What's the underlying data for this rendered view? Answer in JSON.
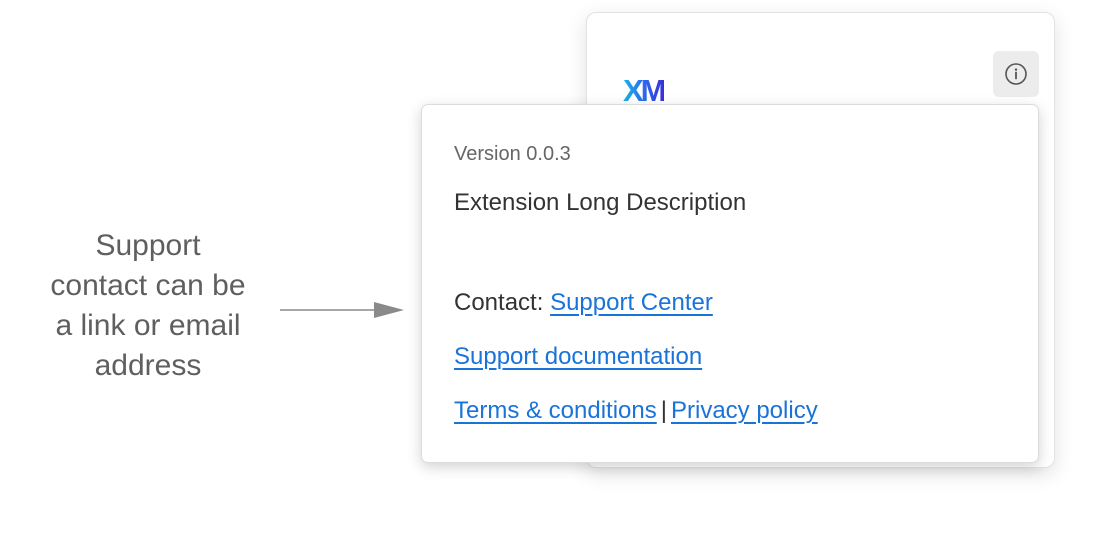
{
  "annotation": {
    "lines": [
      "Support",
      "contact can be",
      "a link or email",
      "address"
    ]
  },
  "card": {
    "logo_text": "XM",
    "info_icon": "info-icon"
  },
  "popover": {
    "version": "Version 0.0.3",
    "description": "Extension Long Description",
    "contact_label": "Contact:",
    "contact_link": "Support Center",
    "documentation_link": "Support documentation",
    "terms_link": "Terms & conditions",
    "separator": "|",
    "privacy_link": "Privacy policy"
  },
  "colors": {
    "link": "#1a73d9",
    "annotation_text": "#5f5f5f",
    "arrow": "#8a8a8a"
  }
}
